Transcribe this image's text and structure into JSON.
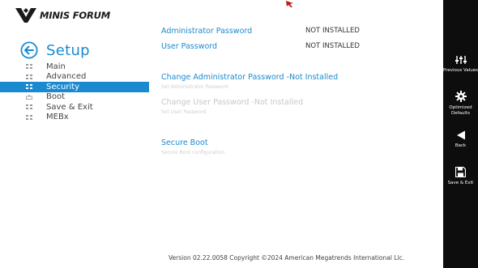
{
  "brand": {
    "name": "MINIS FORUM"
  },
  "setup": {
    "title": "Setup"
  },
  "nav": {
    "items": [
      {
        "label": "Main"
      },
      {
        "label": "Advanced"
      },
      {
        "label": "Security"
      },
      {
        "label": "Boot"
      },
      {
        "label": "Save & Exit"
      },
      {
        "label": "MEBx"
      }
    ],
    "active_index": 2
  },
  "security": {
    "admin_password_label": "Administrator Password",
    "admin_password_value": "NOT INSTALLED",
    "user_password_label": "User Password",
    "user_password_value": "NOT INSTALLED",
    "change_admin_title": "Change Administrator Password -Not Installed",
    "change_admin_desc": "Set Administrator Password",
    "change_user_title": "Change User Password -Not Installed",
    "change_user_desc": "Set User Password",
    "secure_boot_title": "Secure Boot",
    "secure_boot_desc": "Secure Boot configuration"
  },
  "footer": {
    "text": "Version 02.22.0058 Copyright ©2024 American Megatrends International Llc."
  },
  "right_bar": {
    "previous_values": "Previous Values",
    "optimized_defaults": "Optimized Defaults",
    "back": "Back",
    "save_exit": "Save & Exit"
  },
  "colors": {
    "accent": "#1a8ad0",
    "sidebar_bg": "#0d0d0d",
    "disabled_text": "#c8c8c8"
  }
}
